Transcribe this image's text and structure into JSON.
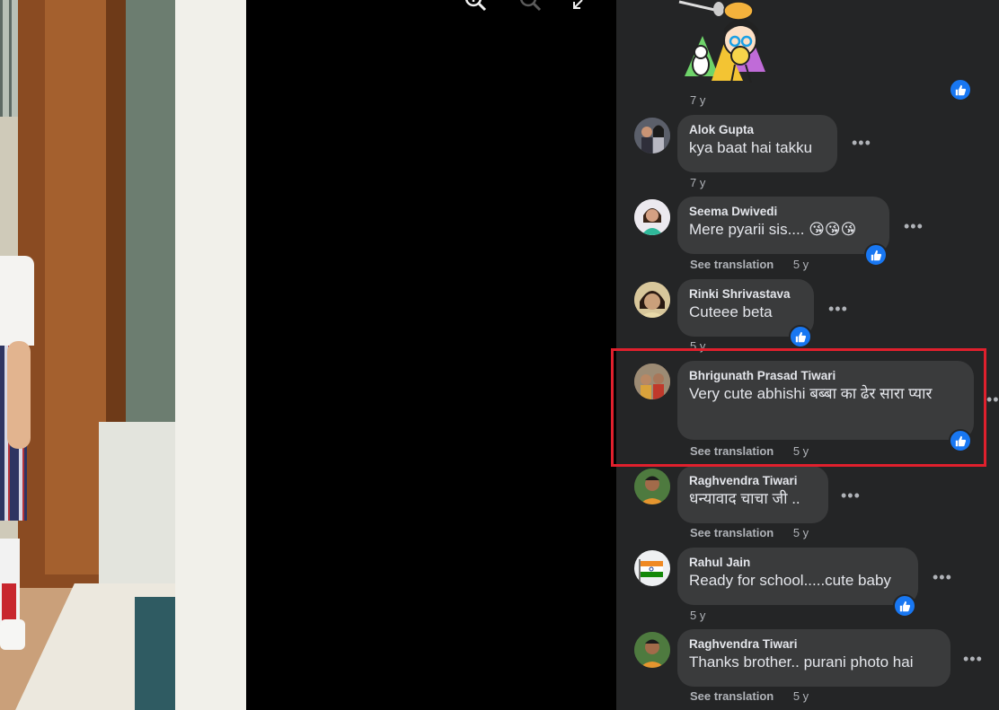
{
  "viewer": {
    "icons": [
      "zoom-in-icon",
      "zoom-out-icon",
      "expand-icon"
    ]
  },
  "comments": [
    {
      "id": "sticker",
      "author": "",
      "text": "",
      "time": "7 y",
      "see_translation": "",
      "liked": true,
      "sticker": "cartoon-girl-sticker"
    },
    {
      "id": "alok",
      "author": "Alok Gupta",
      "text": "kya baat hai takku",
      "time": "7 y",
      "see_translation": "",
      "liked": false
    },
    {
      "id": "seema",
      "author": "Seema Dwivedi",
      "text": "Mere pyarii sis.... 😘😘😘",
      "time": "5 y",
      "see_translation": "See translation",
      "liked": true
    },
    {
      "id": "rinki",
      "author": "Rinki Shrivastava",
      "text": "Cuteee beta",
      "time": "5 y",
      "see_translation": "",
      "liked": true
    },
    {
      "id": "bhrigunath",
      "author": "Bhrigunath Prasad Tiwari",
      "text": "Very cute abhishi बब्बा का ढेर सारा प्यार",
      "time": "5 y",
      "see_translation": "See translation",
      "liked": true,
      "highlighted": true
    },
    {
      "id": "raghvendra1",
      "author": "Raghvendra Tiwari",
      "text": "धन्यावाद चाचा जी ..",
      "time": "5 y",
      "see_translation": "See translation",
      "liked": false
    },
    {
      "id": "rahul",
      "author": "Rahul Jain",
      "text": "Ready for school.....cute baby",
      "time": "5 y",
      "see_translation": "",
      "liked": true
    },
    {
      "id": "raghvendra2",
      "author": "Raghvendra Tiwari",
      "text": "Thanks brother.. purani photo hai",
      "time": "5 y",
      "see_translation": "See translation",
      "liked": false
    }
  ],
  "colors": {
    "panel_bg": "#242526",
    "bubble_bg": "#3a3b3c",
    "text": "#e4e6eb",
    "meta": "#b0b3b8",
    "like_blue": "#1877f2",
    "highlight_red": "#e0202d"
  }
}
